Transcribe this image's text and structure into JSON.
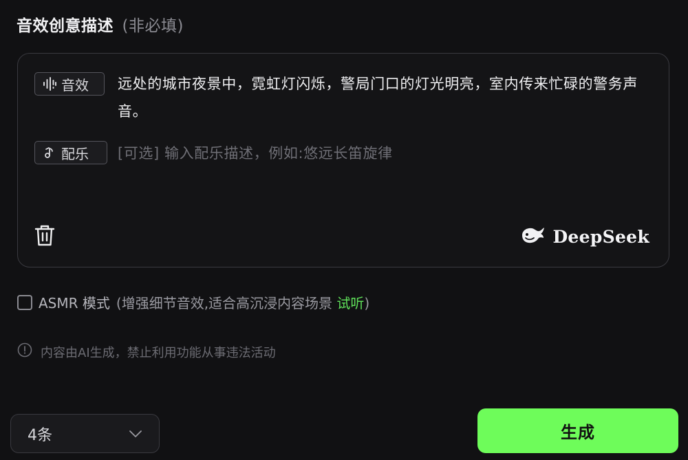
{
  "section": {
    "title": "音效创意描述",
    "optional_hint": "(非必填)"
  },
  "editor": {
    "sfx_tag_label": "音效",
    "sfx_tag_icon": "waveform-icon",
    "sfx_text": "远处的城市夜景中，霓虹灯闪烁，警局门口的灯光明亮，室内传来忙碌的警务声音。",
    "music_tag_label": "配乐",
    "music_tag_icon": "music-note-icon",
    "music_value": "",
    "music_placeholder": "[可选] 输入配乐描述，例如:悠远长笛旋律",
    "delete_icon": "trash-icon",
    "brand_icon": "whale-logo-icon",
    "brand_name": "DeepSeek"
  },
  "asmr": {
    "checked": false,
    "label": "ASMR 模式",
    "description_prefix": "(增强细节音效,适合高沉浸内容场景",
    "listen_link": "试听",
    "description_suffix": ")"
  },
  "notice": {
    "icon": "info-circle-icon",
    "text": "内容由AI生成，禁止利用功能从事违法活动"
  },
  "footer": {
    "count_value": "4条",
    "count_icon": "chevron-down-icon",
    "generate_label": "生成"
  },
  "colors": {
    "accent": "#6efc5a",
    "link": "#5fe05a",
    "background": "#111113",
    "border": "#3a3a40"
  }
}
